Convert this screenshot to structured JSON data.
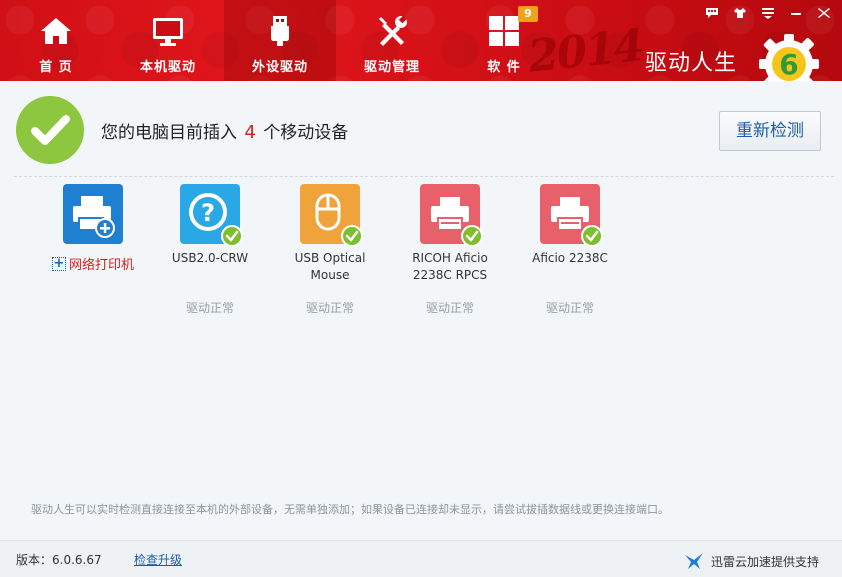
{
  "app": {
    "brand_name": "驱动人生",
    "year_mark": "2014"
  },
  "nav": {
    "items": [
      {
        "label": "首 页",
        "icon": "home-icon"
      },
      {
        "label": "本机驱动",
        "icon": "monitor-icon"
      },
      {
        "label": "外设驱动",
        "icon": "usb-icon",
        "active": true
      },
      {
        "label": "驱动管理",
        "icon": "tools-icon"
      },
      {
        "label": "软 件",
        "icon": "apps-grid-icon",
        "badge": "9"
      }
    ]
  },
  "window_controls": [
    "message-icon",
    "skin-icon",
    "menu-icon",
    "minimize-icon",
    "close-icon"
  ],
  "status": {
    "text_before": "您的电脑目前插入",
    "count": "4",
    "text_after": "个移动设备",
    "recheck_label": "重新检测"
  },
  "devices": [
    {
      "name": "网络打印机",
      "type": "add-network-printer",
      "color": "#1f7fd0",
      "status": ""
    },
    {
      "name": "USB2.0-CRW",
      "type": "unknown-device",
      "color": "#2aa8e6",
      "status": "驱动正常"
    },
    {
      "name": "USB Optical\nMouse",
      "type": "mouse",
      "color": "#f0a33a",
      "status": "驱动正常"
    },
    {
      "name": "RICOH Aficio\n2238C RPCS",
      "type": "printer",
      "color": "#e8606a",
      "status": "驱动正常"
    },
    {
      "name": "Aficio 2238C",
      "type": "printer",
      "color": "#e8606a",
      "status": "驱动正常"
    }
  ],
  "tip": "驱动人生可以实时检测直接连接至本机的外部设备，无需单独添加；如果设备已连接却未显示，请尝试拔插数据线或更换连接端口。",
  "footer": {
    "version": "版本：6.0.6.67",
    "upgrade_label": "检查升级",
    "powered_by": "迅雷云加速提供支持"
  },
  "colors": {
    "header_red": "#d01218",
    "accent_green": "#8dc63f",
    "link_blue": "#1d5ea8",
    "count_red": "#d51f1f"
  }
}
